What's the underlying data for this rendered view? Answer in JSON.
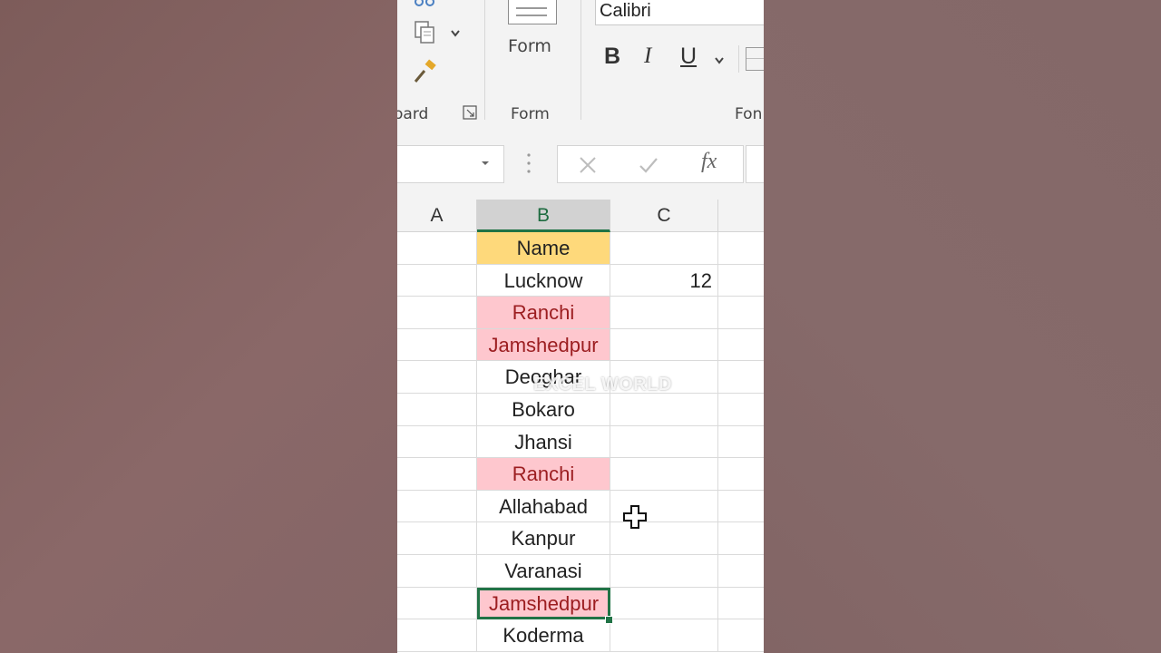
{
  "ribbon": {
    "clipboard_label": "oard",
    "form_button_label": "Form",
    "form_group_label": "Form",
    "font_group_label": "Fon",
    "font_name": "Calibri",
    "bold": "B",
    "italic": "I",
    "underline": "U"
  },
  "formula_bar": {
    "fx_label": "fx"
  },
  "columns": [
    "A",
    "B",
    "C"
  ],
  "selected_column": "B",
  "cells": {
    "header": "Name",
    "names": [
      "Lucknow",
      "Ranchi",
      "Jamshedpur",
      "Deoghar",
      "Bokaro",
      "Jhansi",
      "Ranchi",
      "Allahabad",
      "Kanpur",
      "Varanasi",
      "Jamshedpur",
      "Koderma"
    ],
    "c2": "12"
  },
  "duplicate_highlight": [
    "Ranchi",
    "Jamshedpur"
  ],
  "watermark": "EXCEL WORLD",
  "colors": {
    "header_fill": "#FED97B",
    "duplicate_fill": "#FEC7CE",
    "duplicate_text": "#9C1E21",
    "selection": "#217346"
  }
}
